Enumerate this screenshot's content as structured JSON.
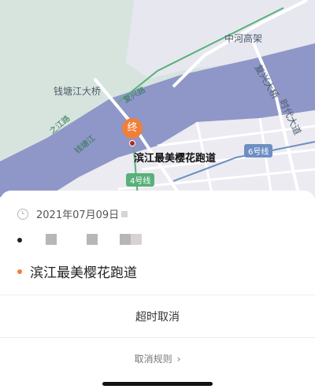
{
  "map": {
    "labels": {
      "zhonghe": "中河高架",
      "qiantang_bridge": "钱塘江大桥",
      "fuxing_bridge": "复兴大桥",
      "shidai": "时代大道",
      "fuxing_road": "复兴路",
      "zhijiang_road": "之江路",
      "qiantang_river": "钱塘江",
      "destination": "滨江最美樱花跑道"
    },
    "metro": {
      "line6": "6号线",
      "line4": "4号线"
    },
    "pin_label": "终"
  },
  "trip": {
    "date": "2021年07月09日",
    "destination": "滨江最美樱花跑道",
    "status": "超时取消",
    "rules_link": "取消规则"
  },
  "colors": {
    "accent": "#f07f3a",
    "river": "#8f96c8",
    "land": "#d7e4de",
    "urban": "#e8e8ef"
  }
}
